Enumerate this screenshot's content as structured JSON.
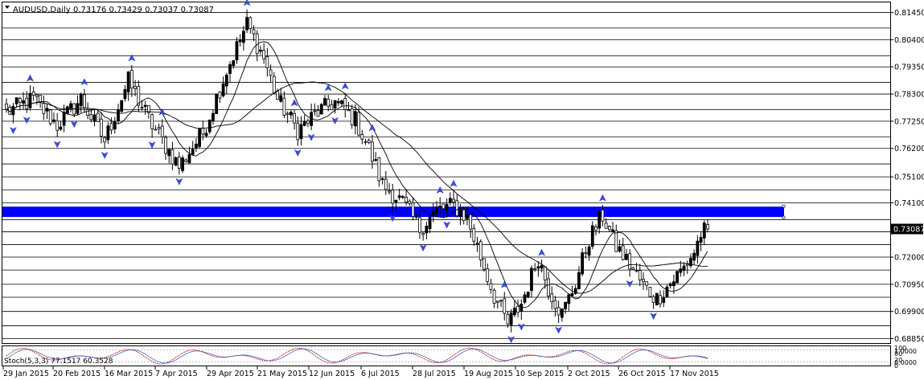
{
  "chart_data": {
    "type": "candlestick",
    "title": "AUDUSD,Daily",
    "ohlc_header": "0.73176 0.73429 0.73037 0.73087",
    "current_price": 0.73087,
    "current_price_label": "0.73087",
    "ylim": [
      0.6868,
      0.8184
    ],
    "y_ticks": [
      0.8145,
      0.804,
      0.7935,
      0.783,
      0.7725,
      0.762,
      0.751,
      0.741,
      0.72,
      0.7095,
      0.699,
      0.6885
    ],
    "y_tick_labels": [
      "0.81450",
      "0.80400",
      "0.79350",
      "0.78300",
      "0.77250",
      "0.76200",
      "0.75100",
      "0.74100",
      "0.72000",
      "0.70950",
      "0.69900",
      "0.68850"
    ],
    "x_tick_labels": [
      "29 Jan 2015",
      "20 Feb 2015",
      "16 Mar 2015",
      "7 Apr 2015",
      "29 Apr 2015",
      "21 May 2015",
      "12 Jun 2015",
      "6 Jul 2015",
      "28 Jul 2015",
      "19 Aug 2015",
      "10 Sep 2015",
      "2 Oct 2015",
      "26 Oct 2015",
      "17 Nov 2015"
    ],
    "anchors": [
      [
        0,
        0.776
      ],
      [
        8,
        0.781
      ],
      [
        15,
        0.771
      ],
      [
        22,
        0.781
      ],
      [
        29,
        0.765
      ],
      [
        36,
        0.788
      ],
      [
        43,
        0.771
      ],
      [
        51,
        0.755
      ],
      [
        58,
        0.768
      ],
      [
        65,
        0.792
      ],
      [
        71,
        0.81
      ],
      [
        76,
        0.797
      ],
      [
        80,
        0.781
      ],
      [
        86,
        0.769
      ],
      [
        92,
        0.776
      ],
      [
        97,
        0.78
      ],
      [
        103,
        0.773
      ],
      [
        107,
        0.762
      ],
      [
        111,
        0.748
      ],
      [
        117,
        0.741
      ],
      [
        122,
        0.731
      ],
      [
        127,
        0.738
      ],
      [
        132,
        0.74
      ],
      [
        136,
        0.735
      ],
      [
        140,
        0.72
      ],
      [
        144,
        0.705
      ],
      [
        148,
        0.694
      ],
      [
        152,
        0.702
      ],
      [
        157,
        0.72
      ],
      [
        160,
        0.708
      ],
      [
        164,
        0.698
      ],
      [
        168,
        0.71
      ],
      [
        172,
        0.727
      ],
      [
        176,
        0.736
      ],
      [
        180,
        0.724
      ],
      [
        184,
        0.717
      ],
      [
        188,
        0.709
      ],
      [
        192,
        0.704
      ],
      [
        196,
        0.71
      ],
      [
        200,
        0.716
      ],
      [
        203,
        0.722
      ],
      [
        205,
        0.729
      ],
      [
        207,
        0.7309
      ]
    ],
    "support_zone": {
      "low": 0.7355,
      "high": 0.7395
    },
    "horizontal_levels": [
      0.8145,
      0.8085,
      0.804,
      0.7978,
      0.7935,
      0.7875,
      0.783,
      0.777,
      0.7725,
      0.7665,
      0.762,
      0.756,
      0.751,
      0.746,
      0.741,
      0.7345,
      0.7298,
      0.7248,
      0.72,
      0.715,
      0.7095,
      0.7045,
      0.699,
      0.6935,
      0.6885
    ],
    "fast_ma_period": 10,
    "slow_ma_period": 30,
    "lower_panel_label": "Stoch(5,3,3) 77.1517 60.3528",
    "lower_panel_right_labels": [
      "100",
      "80",
      "20",
      "0",
      "1.0000",
      "0.0000"
    ]
  }
}
